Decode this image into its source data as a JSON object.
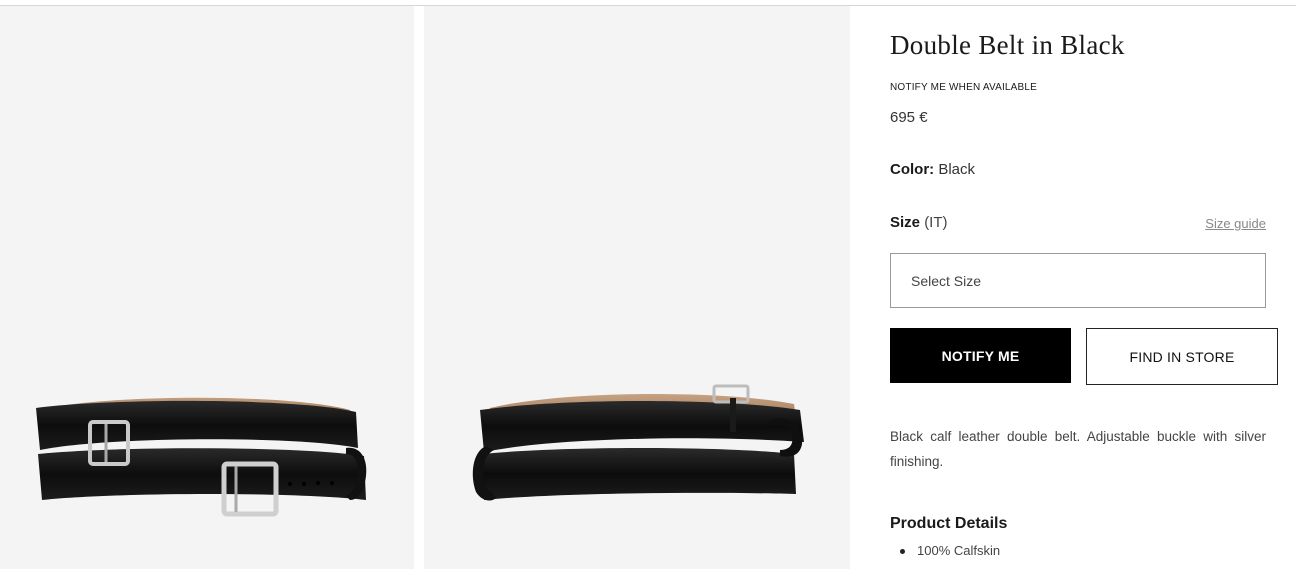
{
  "gallery": {
    "images": [
      {
        "alt": "double-belt-front-view"
      },
      {
        "alt": "double-belt-side-view"
      }
    ]
  },
  "product": {
    "title": "Double Belt in Black",
    "notify_text": "NOTIFY ME WHEN AVAILABLE",
    "price": "695 €",
    "color_label": "Color:",
    "color_value": "Black",
    "size_label": "Size",
    "size_unit": "(IT)",
    "size_guide": "Size guide",
    "size_select_placeholder": "Select Size",
    "description": "Black calf leather double belt. Adjustable buckle with silver finishing.",
    "details_title": "Product Details",
    "details": [
      "100% Calfskin"
    ]
  },
  "actions": {
    "notify_label": "NOTIFY ME",
    "store_label": "FIND IN STORE"
  },
  "colors": {
    "primary_button_bg": "#000000",
    "image_bg": "#f4f4f4",
    "belt_leather": "#111111",
    "belt_lining": "#b08a6a",
    "buckle_silver": "#c9c9c9"
  }
}
